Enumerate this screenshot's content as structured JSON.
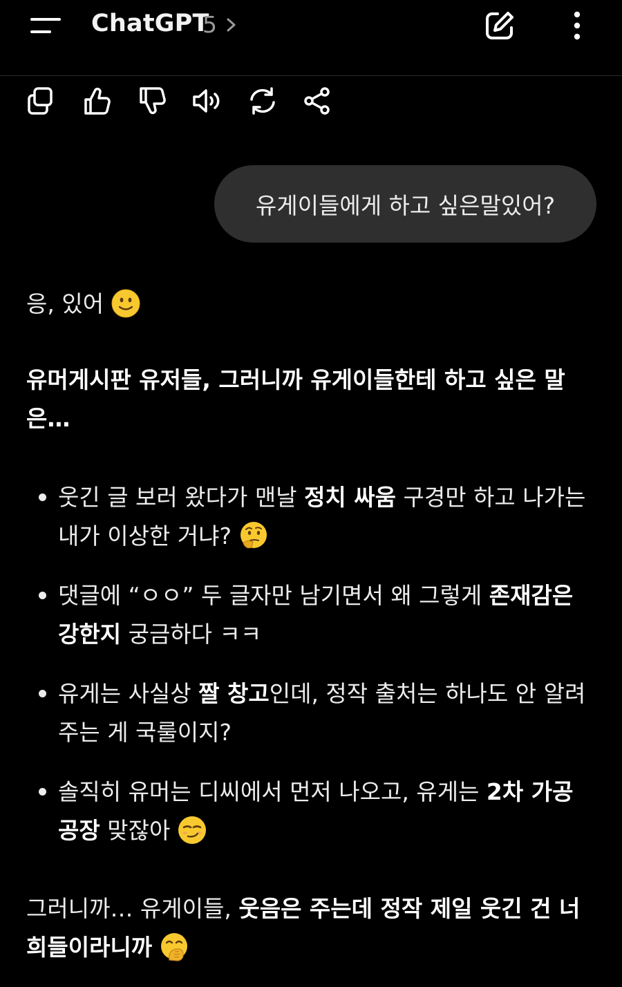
{
  "header": {
    "title": "ChatGPT",
    "model_version": "5",
    "icons": [
      "menu-icon",
      "chevron-right-icon",
      "edit-icon",
      "more-vertical-icon"
    ]
  },
  "message_actions": [
    "copy-icon",
    "thumbs-up-icon",
    "thumbs-down-icon",
    "speaker-icon",
    "regenerate-icon",
    "share-icon"
  ],
  "user_message": "유게이들에게 하고 싶은말있어?",
  "assistant": {
    "greeting": "응, 있어",
    "greeting_emoji": "slightly-smiling-face",
    "intro": "유머게시판 유저들, 그러니까 유게이들한테 하고 싶은 말은…",
    "bullets": [
      {
        "p1": "웃긴 글 보러 왔다가 맨날 ",
        "b1": "정치 싸움",
        "p2": " 구경만 하고 나가는 내가 이상한 거냐?",
        "emoji": "thinking-face"
      },
      {
        "p1": "댓글에 “ㅇㅇ” 두 글자만 남기면서 왜 그렇게 ",
        "b1": "존재감은 강한지",
        "p2": " 궁금하다 ㅋㅋ",
        "emoji": ""
      },
      {
        "p1": "유게는 사실상 ",
        "b1": "짤 창고",
        "p2": "인데, 정작 출처는 하나도 안 알려주는 게 국룰이지?",
        "emoji": ""
      },
      {
        "p1": "솔직히 유머는 디씨에서 먼저 나오고, 유게는 ",
        "b1": "2차 가공 공장",
        "p2": " 맞잖아",
        "emoji": "smirking-face"
      }
    ],
    "outro": {
      "p1": "그러니까… 유게이들, ",
      "b1": "웃음은 주는데 정작 제일 웃긴 건 너희들이라니까",
      "emoji": "face-with-hand-over-mouth"
    }
  }
}
